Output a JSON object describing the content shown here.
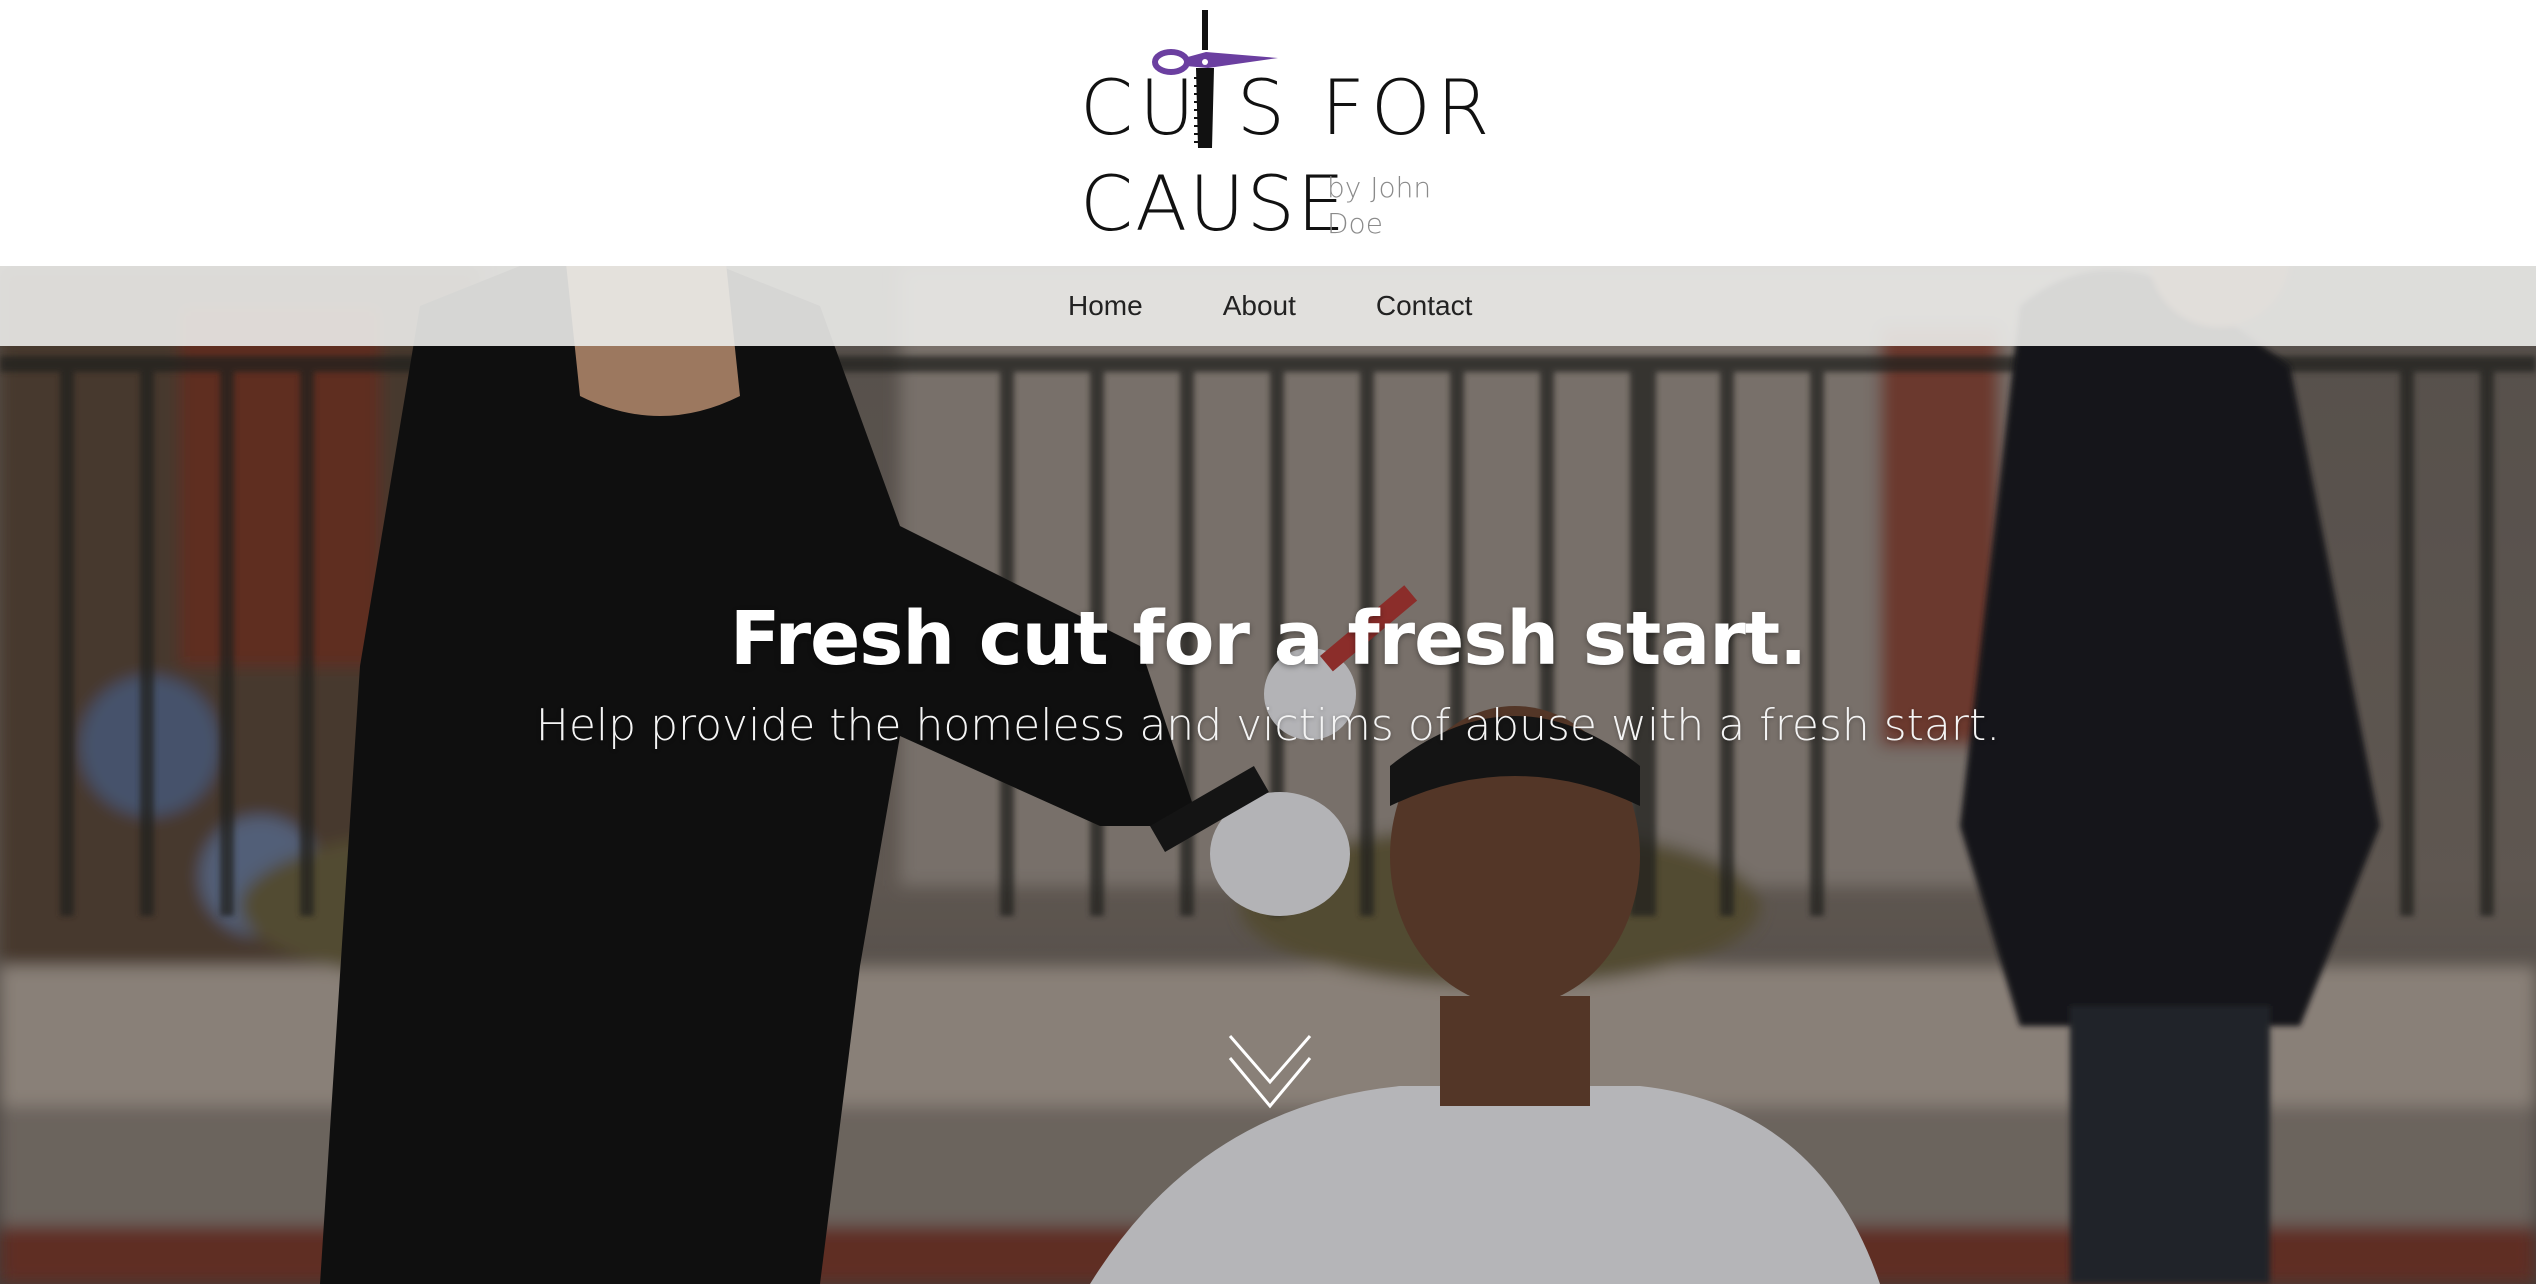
{
  "logo": {
    "line1_left": "CU",
    "line1_right": "S FOR",
    "line2": "CAUSE",
    "byline": "by John Doe",
    "accent_color": "#6b3fa0"
  },
  "nav": {
    "items": [
      {
        "label": "Home"
      },
      {
        "label": "About"
      },
      {
        "label": "Contact"
      }
    ]
  },
  "hero": {
    "title": "Fresh cut for a fresh start.",
    "subtitle": "Help provide the homeless and victims of abuse with a fresh start.",
    "scroll_icon": "chevron-down-icon"
  }
}
